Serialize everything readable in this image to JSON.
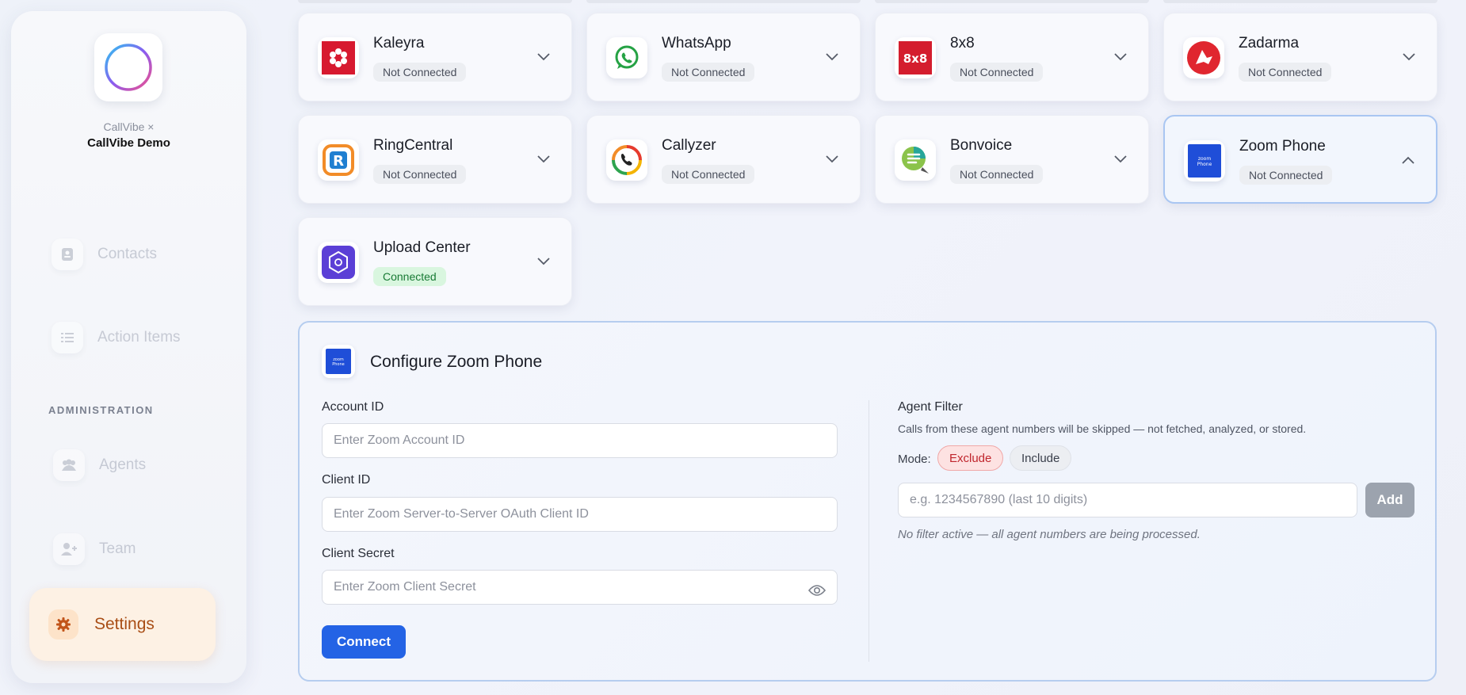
{
  "brand": {
    "subtitle": "CallVibe ×",
    "title": "CallVibe Demo"
  },
  "sidebar": {
    "items": [
      {
        "label": "Contacts",
        "icon": "contact-card-icon"
      },
      {
        "label": "Action Items",
        "icon": "checklist-icon"
      },
      {
        "label": "Agents",
        "icon": "users-icon"
      },
      {
        "label": "Team",
        "icon": "user-add-icon"
      }
    ],
    "section_label": "ADMINISTRATION",
    "settings": {
      "label": "Settings",
      "icon": "gear-icon"
    }
  },
  "integrations": [
    {
      "name": "Kaleyra",
      "status": "Not Connected",
      "connected": false,
      "logo": "kaleyra-logo"
    },
    {
      "name": "WhatsApp",
      "status": "Not Connected",
      "connected": false,
      "logo": "whatsapp-logo"
    },
    {
      "name": "8x8",
      "status": "Not Connected",
      "connected": false,
      "logo": "8x8-logo"
    },
    {
      "name": "Zadarma",
      "status": "Not Connected",
      "connected": false,
      "logo": "zadarma-logo"
    },
    {
      "name": "RingCentral",
      "status": "Not Connected",
      "connected": false,
      "logo": "ringcentral-logo"
    },
    {
      "name": "Callyzer",
      "status": "Not Connected",
      "connected": false,
      "logo": "callyzer-logo"
    },
    {
      "name": "Bonvoice",
      "status": "Not Connected",
      "connected": false,
      "logo": "bonvoice-logo"
    },
    {
      "name": "Zoom Phone",
      "status": "Not Connected",
      "connected": false,
      "logo": "zoom-phone-logo",
      "expanded": true
    },
    {
      "name": "Upload Center",
      "status": "Connected",
      "connected": true,
      "logo": "upload-center-logo"
    }
  ],
  "config": {
    "title": "Configure Zoom Phone",
    "logo_text": "zoom Phone",
    "account_id": {
      "label": "Account ID",
      "placeholder": "Enter Zoom Account ID",
      "value": ""
    },
    "client_id": {
      "label": "Client ID",
      "placeholder": "Enter Zoom Server-to-Server OAuth Client ID",
      "value": ""
    },
    "client_secret": {
      "label": "Client Secret",
      "placeholder": "Enter Zoom Client Secret",
      "value": ""
    },
    "connect_label": "Connect",
    "agent_filter": {
      "title": "Agent Filter",
      "description": "Calls from these agent numbers will be skipped — not fetched, analyzed, or stored.",
      "mode_label": "Mode:",
      "mode_options": [
        "Exclude",
        "Include"
      ],
      "selected_mode": "Exclude",
      "input_placeholder": "e.g. 1234567890 (last 10 digits)",
      "add_label": "Add",
      "note": "No filter active — all agent numbers are being processed."
    }
  },
  "colors": {
    "accent": "#2463e5",
    "settings_bg": "#fdf1e4",
    "settings_text": "#a94e16",
    "connected_bg": "#d9f6df",
    "exclude_bg": "#fde2e2"
  }
}
